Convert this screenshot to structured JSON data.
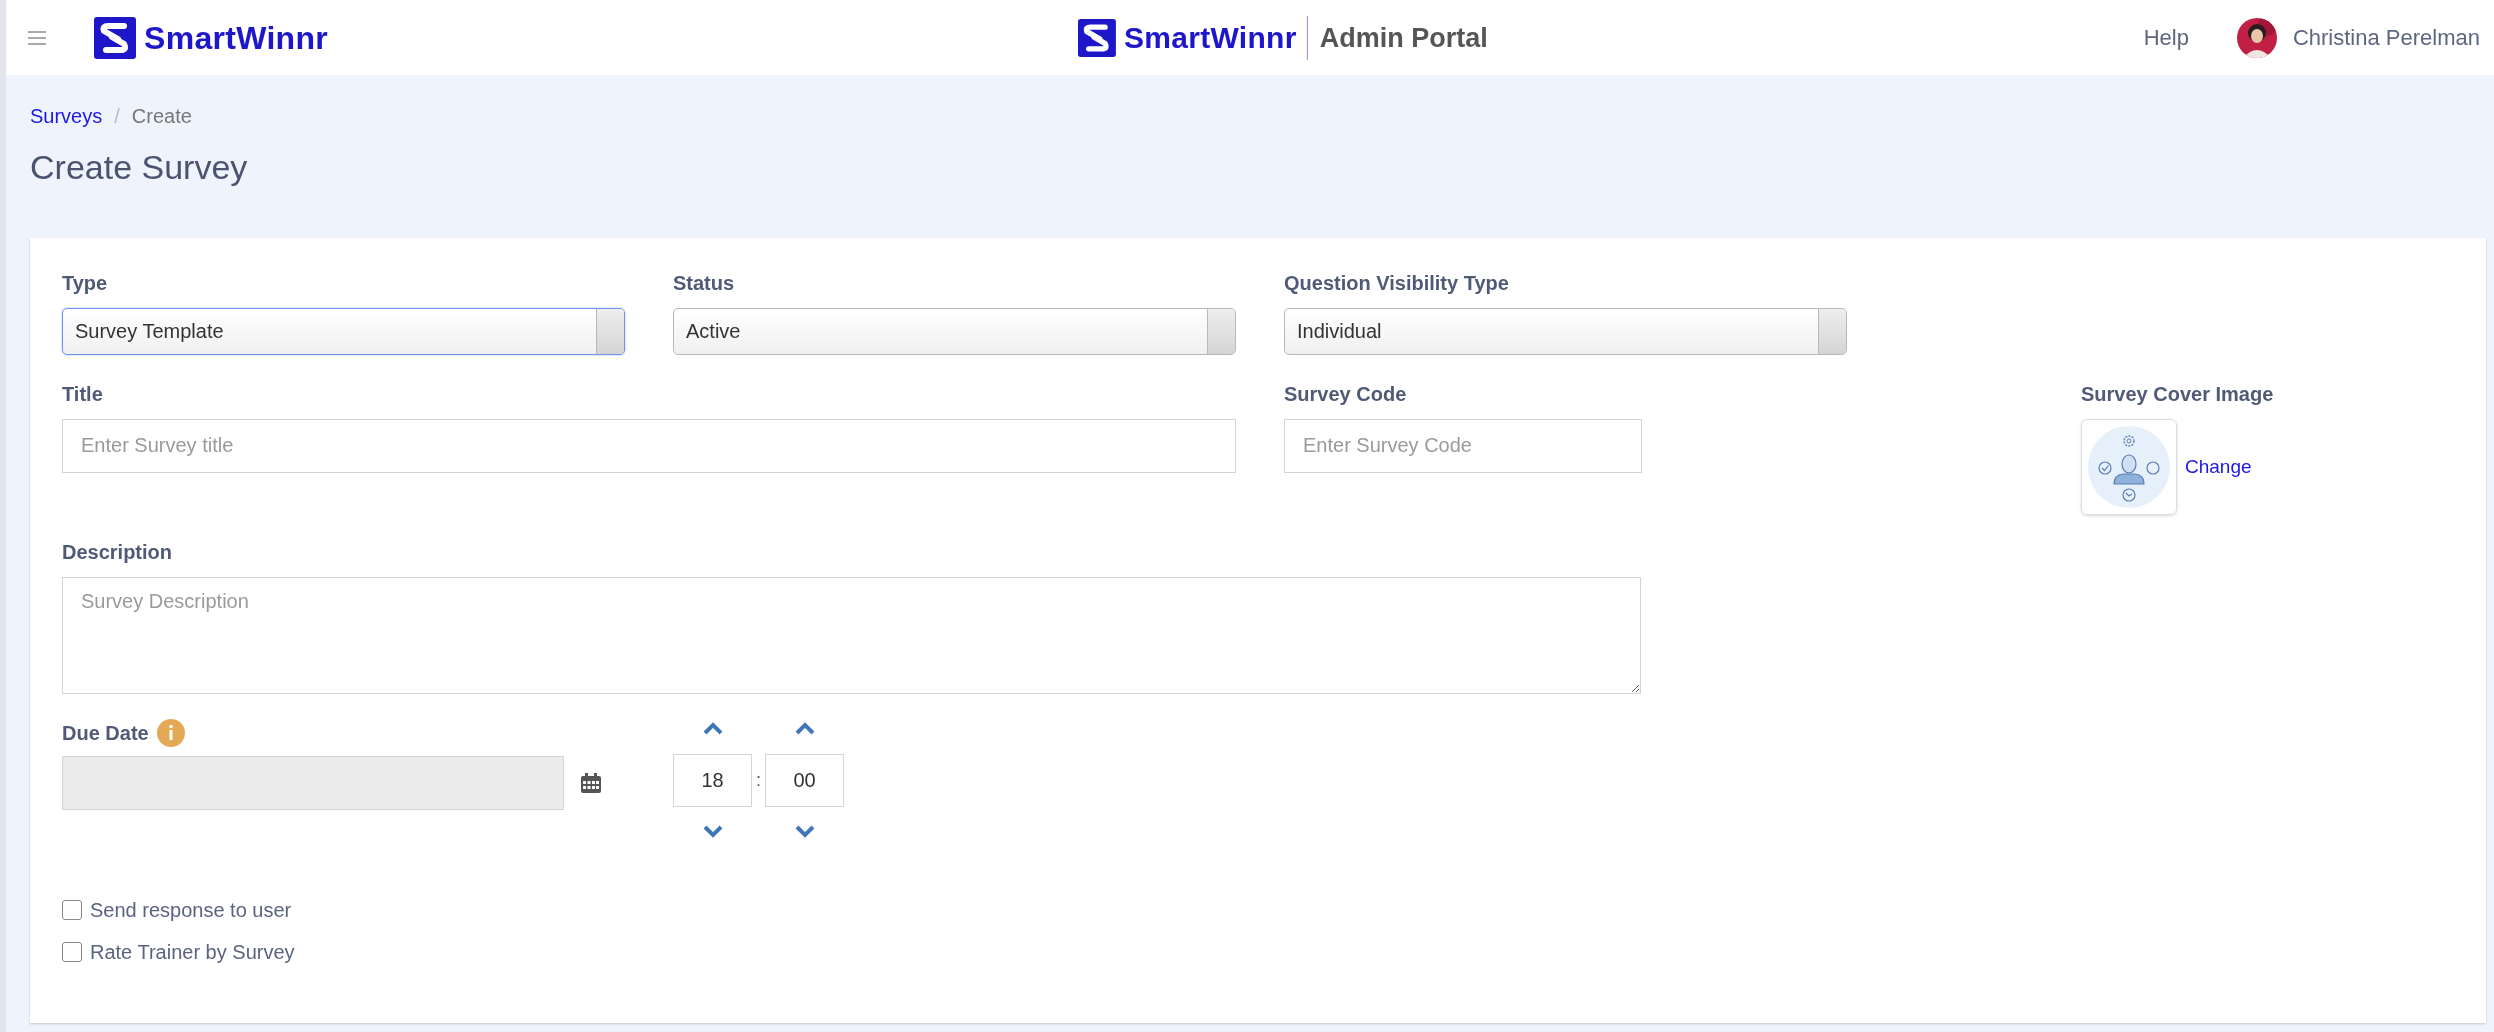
{
  "header": {
    "brand": "SmartWinnr",
    "center_brand": "SmartWinnr",
    "portal": "Admin Portal",
    "help": "Help",
    "user": "Christina Perelman"
  },
  "breadcrumb_separator": "/",
  "breadcrumb": [
    {
      "label": "Surveys",
      "current": false
    },
    {
      "label": "Create",
      "current": true
    }
  ],
  "page_title": "Create Survey",
  "selects": [
    {
      "label": "Type",
      "value": "Survey Template",
      "focused": true
    },
    {
      "label": "Status",
      "value": "Active",
      "focused": false
    },
    {
      "label": "Question Visibility Type",
      "value": "Individual",
      "focused": false
    }
  ],
  "title_field": {
    "label": "Title",
    "placeholder": "Enter Survey title"
  },
  "code_field": {
    "label": "Survey Code",
    "placeholder": "Enter Survey Code"
  },
  "cover_image": {
    "label": "Survey Cover Image",
    "action": "Change"
  },
  "description": {
    "label": "Description",
    "placeholder": "Survey Description"
  },
  "due_date": {
    "label": "Due Date",
    "disabled": true
  },
  "time": {
    "hours": "18",
    "separator": ":",
    "minutes": "00"
  },
  "checkboxes": [
    {
      "label": "Send response to user",
      "checked": false
    },
    {
      "label": "Rate Trainer by Survey",
      "checked": false
    }
  ]
}
